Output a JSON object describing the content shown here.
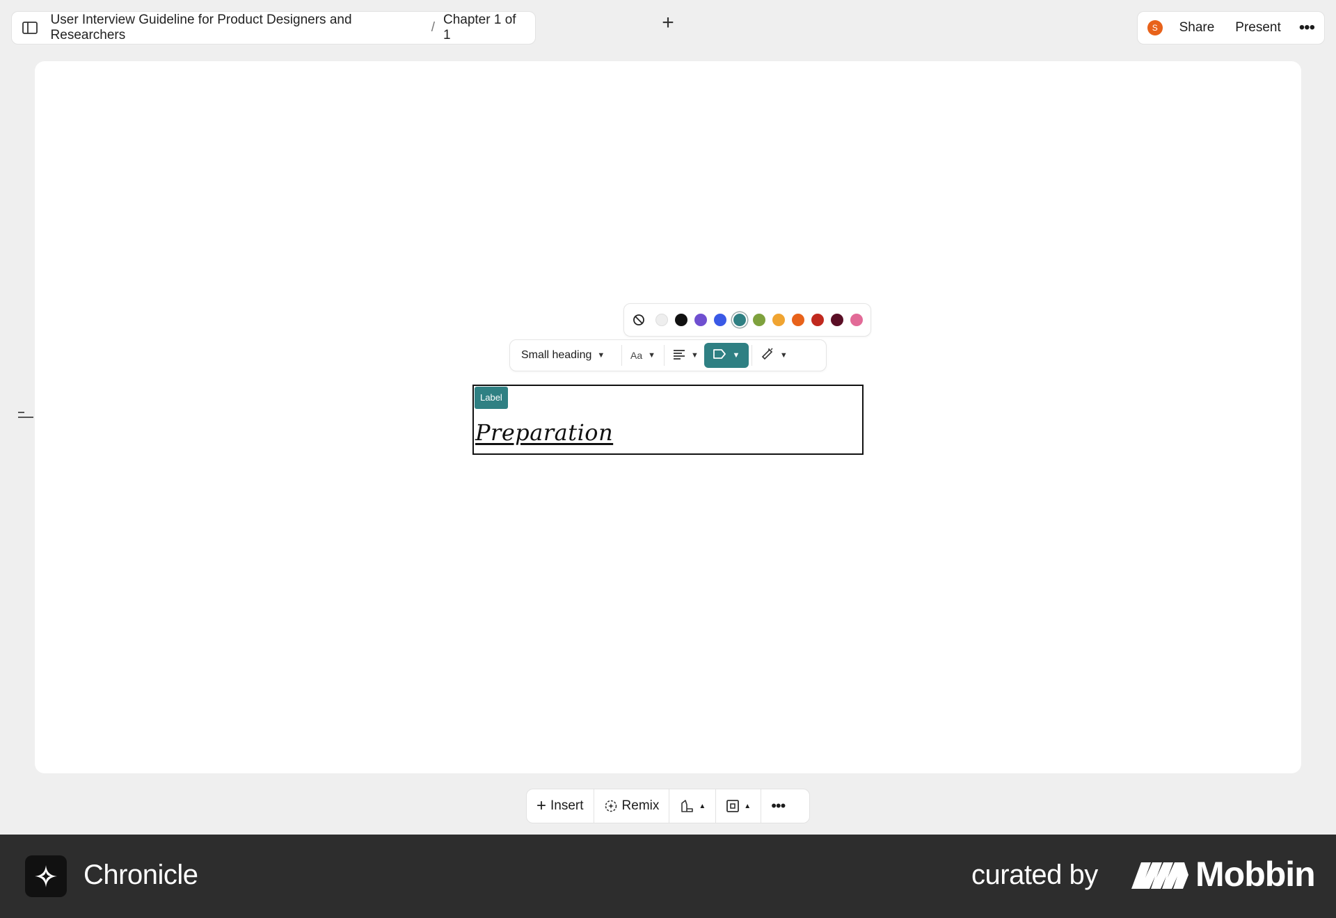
{
  "header": {
    "doc_title": "User Interview Guideline for Product Designers and Researchers",
    "separator": "/",
    "chapter": "Chapter 1 of 1",
    "add_label": "+"
  },
  "top_right": {
    "avatar_initial": "S",
    "avatar_color": "#e8621a",
    "share_label": "Share",
    "present_label": "Present",
    "more_label": "•••"
  },
  "palette": {
    "selected": "#2f8083",
    "colors": [
      "#eeeeee",
      "#111111",
      "#6f4fd0",
      "#3a59e6",
      "#2f8083",
      "#7ea13d",
      "#f0a431",
      "#e8621a",
      "#c0291e",
      "#5a0e25",
      "#e26a97"
    ]
  },
  "format_toolbar": {
    "text_style": "Small heading",
    "font_label": "Aa",
    "active_color": "#2f8083"
  },
  "block": {
    "label": "Label",
    "heading": "Preparation"
  },
  "bottom_toolbar": {
    "insert_label": "Insert",
    "remix_label": "Remix",
    "more_label": "•••"
  },
  "footer": {
    "brand": "Chronicle",
    "curated_by": "curated by",
    "curator": "Mobbin"
  }
}
